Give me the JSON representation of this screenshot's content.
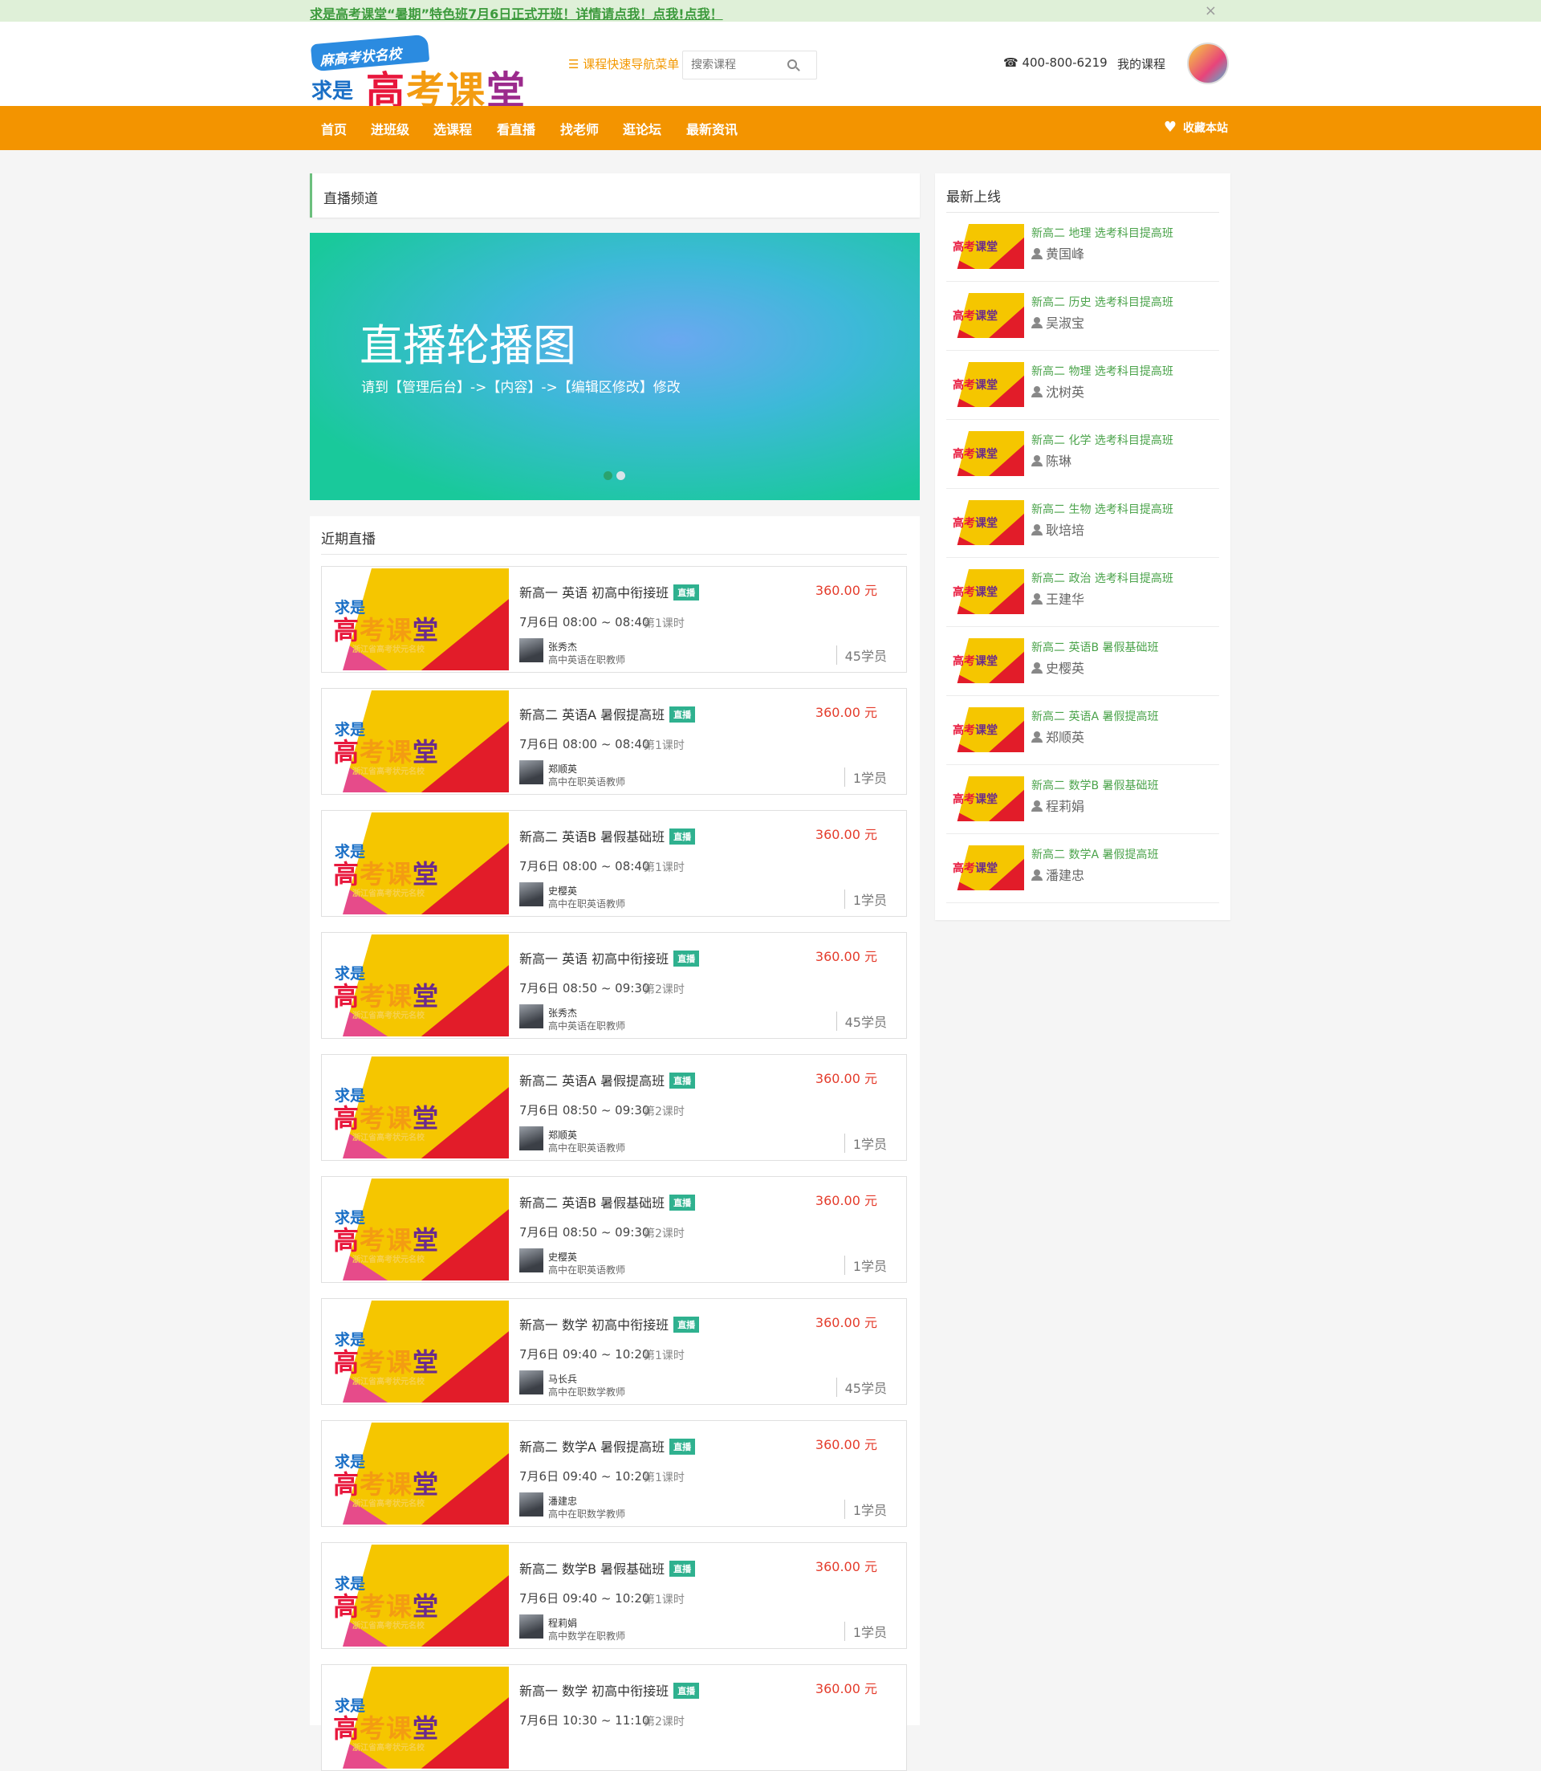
{
  "notice": {
    "text": "求是高考课堂“暑期”特色班7月6日正式开班！详情请点我！点我!点我！",
    "close": "×"
  },
  "header": {
    "logo_tag": "麻高考状名校",
    "logo_qs": "求是",
    "logo_g": "高",
    "logo_k": "考课",
    "logo_t": "堂",
    "quicknav": "☰ 课程快速导航菜单",
    "search_placeholder": "搜索课程",
    "phone": "☎ 400-800-6219",
    "mycourse": "我的课程"
  },
  "nav": {
    "items": [
      "首页",
      "进班级",
      "选课程",
      "看直播",
      "找老师",
      "逛论坛",
      "最新资讯"
    ],
    "favorite": "收藏本站",
    "heart": "♥"
  },
  "channel_title": "直播频道",
  "banner": {
    "title": "直播轮播图",
    "subtitle": "请到【管理后台】->【内容】->【编辑区修改】修改"
  },
  "recent": {
    "title": "近期直播",
    "live_tag": "直播",
    "thumb": {
      "qs": "求是",
      "g": "高",
      "k": "考课",
      "t": "堂",
      "sub": "浙江省高考状元名校"
    },
    "cards": [
      {
        "title": "新高一 英语 初高中衔接班",
        "time": "7月6日 08:00 ~ 08:40",
        "lesson": "第1课时",
        "price": "360.00 元",
        "teacher": "张秀杰",
        "role": "高中英语在职教师",
        "students": "45学员"
      },
      {
        "title": "新高二 英语A 暑假提高班",
        "time": "7月6日 08:00 ~ 08:40",
        "lesson": "第1课时",
        "price": "360.00 元",
        "teacher": "郑顺英",
        "role": "高中在职英语教师",
        "students": "1学员"
      },
      {
        "title": "新高二 英语B 暑假基础班",
        "time": "7月6日 08:00 ~ 08:40",
        "lesson": "第1课时",
        "price": "360.00 元",
        "teacher": "史樱英",
        "role": "高中在职英语教师",
        "students": "1学员"
      },
      {
        "title": "新高一 英语 初高中衔接班",
        "time": "7月6日 08:50 ~ 09:30",
        "lesson": "第2课时",
        "price": "360.00 元",
        "teacher": "张秀杰",
        "role": "高中英语在职教师",
        "students": "45学员"
      },
      {
        "title": "新高二 英语A 暑假提高班",
        "time": "7月6日 08:50 ~ 09:30",
        "lesson": "第2课时",
        "price": "360.00 元",
        "teacher": "郑顺英",
        "role": "高中在职英语教师",
        "students": "1学员"
      },
      {
        "title": "新高二 英语B 暑假基础班",
        "time": "7月6日 08:50 ~ 09:30",
        "lesson": "第2课时",
        "price": "360.00 元",
        "teacher": "史樱英",
        "role": "高中在职英语教师",
        "students": "1学员"
      },
      {
        "title": "新高一 数学 初高中衔接班",
        "time": "7月6日 09:40 ~ 10:20",
        "lesson": "第1课时",
        "price": "360.00 元",
        "teacher": "马长兵",
        "role": "高中在职数学教师",
        "students": "45学员"
      },
      {
        "title": "新高二 数学A 暑假提高班",
        "time": "7月6日 09:40 ~ 10:20",
        "lesson": "第1课时",
        "price": "360.00 元",
        "teacher": "潘建忠",
        "role": "高中在职数学教师",
        "students": "1学员"
      },
      {
        "title": "新高二 数学B 暑假基础班",
        "time": "7月6日 09:40 ~ 10:20",
        "lesson": "第1课时",
        "price": "360.00 元",
        "teacher": "程莉娟",
        "role": "高中数学在职教师",
        "students": "1学员"
      },
      {
        "title": "新高一 数学 初高中衔接班",
        "time": "7月6日 10:30 ~ 11:10",
        "lesson": "第2课时",
        "price": "360.00 元",
        "teacher": "",
        "role": "",
        "students": ""
      }
    ]
  },
  "sidebar": {
    "title": "最新上线",
    "thumb": {
      "g": "高考",
      "t": "课堂"
    },
    "items": [
      {
        "name": "新高二 地理 选考科目提高班",
        "teacher": "黄国峰"
      },
      {
        "name": "新高二 历史 选考科目提高班",
        "teacher": "吴淑宝"
      },
      {
        "name": "新高二 物理 选考科目提高班",
        "teacher": "沈树英"
      },
      {
        "name": "新高二 化学 选考科目提高班",
        "teacher": "陈琳"
      },
      {
        "name": "新高二 生物 选考科目提高班",
        "teacher": "耿培培"
      },
      {
        "name": "新高二 政治 选考科目提高班",
        "teacher": "王建华"
      },
      {
        "name": "新高二 英语B 暑假基础班",
        "teacher": "史樱英"
      },
      {
        "name": "新高二 英语A 暑假提高班",
        "teacher": "郑顺英"
      },
      {
        "name": "新高二 数学B 暑假基础班",
        "teacher": "程莉娟"
      },
      {
        "name": "新高二 数学A 暑假提高班",
        "teacher": "潘建忠"
      }
    ]
  },
  "colors": {
    "orange": "#f39400",
    "green": "#4aa34a",
    "price_red": "#e43b2b",
    "live_tag": "#2fb18f"
  }
}
